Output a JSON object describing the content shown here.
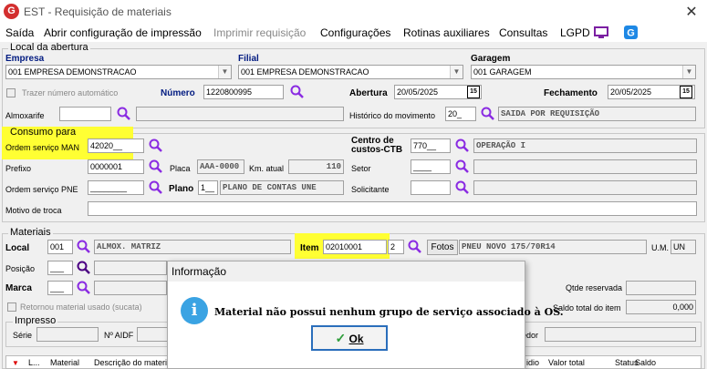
{
  "window": {
    "title": "EST - Requisição de materiais",
    "logo_letter": "G",
    "close_glyph": "✕"
  },
  "menu": [
    {
      "label": "Saída",
      "enabled": true
    },
    {
      "label": "Abrir configuração de impressão",
      "enabled": true
    },
    {
      "label": "Imprimir requisição",
      "enabled": false
    },
    {
      "label": "Configurações",
      "enabled": true
    },
    {
      "label": "Rotinas auxiliares",
      "enabled": true
    },
    {
      "label": "Consultas",
      "enabled": true
    },
    {
      "label": "LGPD",
      "enabled": true
    }
  ],
  "local_abertura": {
    "legend": "Local da abertura",
    "empresa_label": "Empresa",
    "empresa_value": "001 EMPRESA DEMONSTRACAO",
    "filial_label": "Filial",
    "filial_value": "001 EMPRESA DEMONSTRACAO",
    "garagem_label": "Garagem",
    "garagem_value": "001 GARAGEM",
    "auto_number_label": "Trazer número automático",
    "numero_label": "Número",
    "numero_value": "1220800995",
    "abertura_label": "Abertura",
    "abertura_value": "20/05/2025",
    "fechamento_label": "Fechamento",
    "fechamento_value": "20/05/2025",
    "calendar_glyph": "15",
    "almoxarife_label": "Almoxarife",
    "almoxarife_value": "",
    "historico_label": "Histórico do movimento",
    "historico_code": "20_",
    "historico_desc": "SAIDA POR REQUISIÇÃO"
  },
  "consumo": {
    "legend": "Consumo para",
    "os_man_label": "Ordem serviço MAN",
    "os_man_value": "42020__",
    "centro_label": "Centro de custos-CTB",
    "centro_code": "770__",
    "centro_desc": "OPERAÇÃO I",
    "prefixo_label": "Prefixo",
    "prefixo_value": "0000001",
    "placa_label": "Placa",
    "placa_value": "AAA-0000",
    "km_label": "Km. atual",
    "km_value": "110",
    "setor_label": "Setor",
    "setor_value": "____",
    "os_pne_label": "Ordem serviço PNE",
    "os_pne_value": "________",
    "plano_label": "Plano",
    "plano_code": "1__",
    "plano_desc": "PLANO DE CONTAS UNE",
    "solicitante_label": "Solicitante",
    "solicitante_value": "",
    "motivo_label": "Motivo de troca",
    "motivo_value": ""
  },
  "materiais": {
    "legend": "Materiais",
    "local_label": "Local",
    "local_code": "001",
    "local_desc": "ALMOX. MATRIZ",
    "item_label": "Item",
    "item_value": "02010001",
    "item_digit": "2",
    "fotos_label": "Fotos",
    "item_desc": "PNEU NOVO 175/70R14",
    "um_label": "U.M.",
    "um_value": "UN",
    "posicao_label": "Posição",
    "posicao_value": "___",
    "marca_label": "Marca",
    "marca_value": "___",
    "qtde_label": "Qtde reservada",
    "retornou_label": "Retornou material usado (sucata)",
    "saldo_label": "Saldo total do item",
    "saldo_value": "0,000"
  },
  "impresso": {
    "legend": "Impresso",
    "serie_label": "Série",
    "aidf_label": "Nº AIDF",
    "fornecedor_label": "edor"
  },
  "table": {
    "headers": [
      "L...",
      "Material",
      "Descrição do material",
      "idio",
      "Valor total",
      "Status",
      "Saldo"
    ]
  },
  "dialog": {
    "title": "Informação",
    "icon_glyph": "i",
    "message": "Material não possui nenhum grupo de serviço associado à OS.",
    "ok_label": "Ok",
    "ok_check": "✓"
  },
  "colors": {
    "highlight": "#ffff33",
    "search_icon": "#8a2be2",
    "info": "#3aa3e3",
    "ok_border": "#2a6ebb"
  }
}
